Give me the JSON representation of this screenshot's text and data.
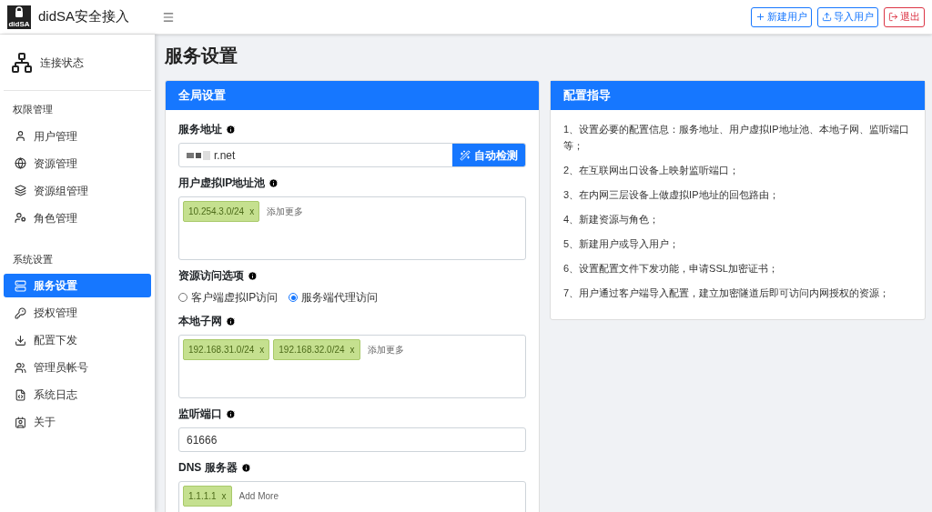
{
  "header": {
    "brand": "didSA安全接入",
    "logo_text": "didSA",
    "buttons": [
      {
        "kind": "add",
        "label": "新建用户"
      },
      {
        "kind": "import",
        "label": "导入用户"
      },
      {
        "kind": "logout",
        "label": "退出"
      }
    ]
  },
  "sidebar": {
    "status": {
      "label": "连接状态"
    },
    "groups": [
      {
        "title": "权限管理",
        "items": [
          {
            "label": "用户管理",
            "selected": false
          },
          {
            "label": "资源管理",
            "selected": false
          },
          {
            "label": "资源组管理",
            "selected": false
          },
          {
            "label": "角色管理",
            "selected": false
          }
        ]
      },
      {
        "title": "系统设置",
        "items": [
          {
            "label": "服务设置",
            "selected": true
          },
          {
            "label": "授权管理",
            "selected": false
          },
          {
            "label": "配置下发",
            "selected": false
          },
          {
            "label": "管理员帐号",
            "selected": false
          },
          {
            "label": "系统日志",
            "selected": false
          },
          {
            "label": "关于",
            "selected": false
          }
        ]
      }
    ]
  },
  "page_title": "服务设置",
  "global_settings": {
    "title": "全局设置",
    "fields": [
      {
        "kind": "address",
        "label": "服务地址",
        "value": "r.net",
        "button": "自动检测"
      },
      {
        "kind": "tags",
        "label": "用户虚拟IP地址池",
        "tags": [
          {
            "label": "10.254.3.0/24",
            "remove": "x"
          }
        ],
        "placeholder": "添加更多"
      },
      {
        "kind": "radio",
        "label": "资源访问选项",
        "options": [
          {
            "label": "客户端虚拟IP访问",
            "selected": false
          },
          {
            "label": "服务端代理访问",
            "selected": true
          }
        ]
      },
      {
        "kind": "tags",
        "label": "本地子网",
        "tags": [
          {
            "label": "192.168.31.0/24",
            "remove": "x"
          },
          {
            "label": "192.168.32.0/24",
            "remove": "x"
          }
        ],
        "placeholder": "添加更多"
      },
      {
        "kind": "text",
        "label": "监听端口",
        "value": "61666"
      },
      {
        "kind": "tags",
        "label": "DNS 服务器",
        "tags": [
          {
            "label": "1.1.1.1",
            "remove": "x"
          }
        ],
        "placeholder": "Add More"
      }
    ]
  },
  "guide": {
    "title": "配置指导",
    "steps": [
      "1、设置必要的配置信息：服务地址、用户虚拟IP地址池、本地子网、监听端口等；",
      "2、在互联网出口设备上映射监听端口；",
      "3、在内网三层设备上做虚拟IP地址的回包路由；",
      "4、新建资源与角色；",
      "5、新建用户或导入用户；",
      "6、设置配置文件下发功能，申请SSL加密证书；",
      "7、用户通过客户端导入配置，建立加密隧道后即可访问内网授权的资源；"
    ]
  }
}
